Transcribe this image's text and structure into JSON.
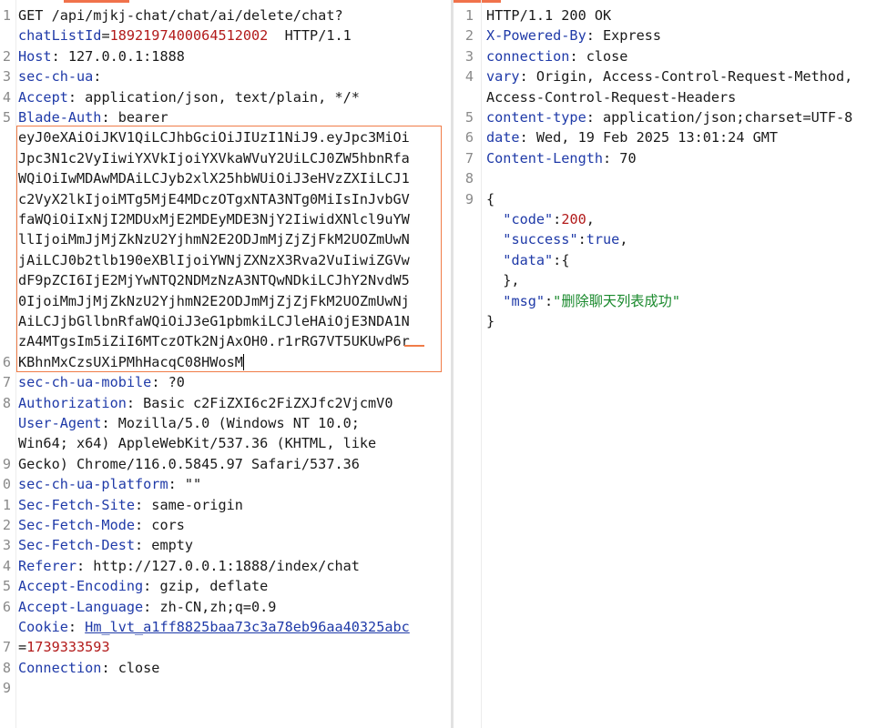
{
  "request": {
    "line_numbers": [
      "1",
      "",
      "2",
      "3",
      "4",
      "5",
      "",
      "",
      "",
      "",
      "",
      "",
      "",
      "",
      "",
      "",
      "",
      "6",
      "7",
      "8",
      "",
      "",
      "9",
      "0",
      "1",
      "2",
      "3",
      "4",
      "5",
      "6",
      "",
      "7",
      "8",
      "9"
    ],
    "lines": [
      {
        "segments": [
          {
            "text": "GET /api/mjkj-chat/chat/ai/delete/chat?",
            "c": "v"
          }
        ]
      },
      {
        "segments": [
          {
            "text": "chatListId",
            "c": "k"
          },
          {
            "text": "=",
            "c": "v"
          },
          {
            "text": "1892197400064512002",
            "c": "r"
          },
          {
            "text": "  HTTP/1.1",
            "c": "v"
          }
        ]
      },
      {
        "segments": [
          {
            "text": "Host",
            "c": "k"
          },
          {
            "text": ": 127.0.0.1:1888",
            "c": "v"
          }
        ]
      },
      {
        "segments": [
          {
            "text": "sec-ch-ua",
            "c": "k"
          },
          {
            "text": ":",
            "c": "v"
          }
        ]
      },
      {
        "segments": [
          {
            "text": "Accept",
            "c": "k"
          },
          {
            "text": ": application/json, text/plain, */*",
            "c": "v"
          }
        ]
      },
      {
        "segments": [
          {
            "text": "Blade-Auth",
            "c": "k"
          },
          {
            "text": ": bearer",
            "c": "v"
          }
        ]
      },
      {
        "segments": [
          {
            "text": "eyJ0eXAiOiJKV1QiLCJhbGciOiJIUzI1NiJ9.eyJpc3MiOi",
            "c": "v"
          }
        ]
      },
      {
        "segments": [
          {
            "text": "Jpc3N1c2VyIiwiYXVkIjoiYXVkaWVuY2UiLCJ0ZW5hbnRfa",
            "c": "v"
          }
        ]
      },
      {
        "segments": [
          {
            "text": "WQiOiIwMDAwMDAiLCJyb2xlX25hbWUiOiJ3eHVzZXIiLCJ1",
            "c": "v"
          }
        ]
      },
      {
        "segments": [
          {
            "text": "c2VyX2lkIjoiMTg5MjE4MDczOTgxNTA3NTg0MiIsInJvbGV",
            "c": "v"
          }
        ]
      },
      {
        "segments": [
          {
            "text": "faWQiOiIxNjI2MDUxMjE2MDEyMDE3NjY2IiwidXNlcl9uYW",
            "c": "v"
          }
        ]
      },
      {
        "segments": [
          {
            "text": "llIjoiMmJjMjZkNzU2YjhmN2E2ODJmMjZjZjFkM2UOZmUwN",
            "c": "v"
          }
        ]
      },
      {
        "segments": [
          {
            "text": "jAiLCJ0b2tlb190eXBlIjoiYWNjZXNzX3Rva2VuIiwiZGVw",
            "c": "v"
          }
        ]
      },
      {
        "segments": [
          {
            "text": "dF9pZCI6IjE2MjYwNTQ2NDMzNzA3NTQwNDkiLCJhY2NvdW5",
            "c": "v"
          }
        ]
      },
      {
        "segments": [
          {
            "text": "0IjoiMmJjMjZkNzU2YjhmN2E2ODJmMjZjZjFkM2UOZmUwNj",
            "c": "v"
          }
        ]
      },
      {
        "segments": [
          {
            "text": "AiLCJjbGllbnRfaWQiOiJ3eG1pbmkiLCJleHAiOjE3NDA1N",
            "c": "v"
          }
        ]
      },
      {
        "segments": [
          {
            "text": "zA4MTgsIm5iZiI6MTczOTk2NjAxOH0.r1rRG7VT5UKUwP6r",
            "c": "v"
          }
        ]
      },
      {
        "segments": [
          {
            "text": "KBhnMxCzsUXiPMhHacqC08HWosM",
            "c": "v"
          }
        ],
        "caret": true
      },
      {
        "segments": [
          {
            "text": "sec-ch-ua-mobile",
            "c": "k"
          },
          {
            "text": ": ?0",
            "c": "v"
          }
        ]
      },
      {
        "segments": [
          {
            "text": "Authorization",
            "c": "k"
          },
          {
            "text": ": Basic c2FiZXI6c2FiZXJfc2VjcmV0",
            "c": "v"
          }
        ]
      },
      {
        "segments": [
          {
            "text": "User-Agent",
            "c": "k"
          },
          {
            "text": ": Mozilla/5.0 (Windows NT 10.0;",
            "c": "v"
          }
        ]
      },
      {
        "segments": [
          {
            "text": "Win64; x64) AppleWebKit/537.36 (KHTML, like",
            "c": "v"
          }
        ]
      },
      {
        "segments": [
          {
            "text": "Gecko) Chrome/116.0.5845.97 Safari/537.36",
            "c": "v"
          }
        ]
      },
      {
        "segments": [
          {
            "text": "sec-ch-ua-platform",
            "c": "k"
          },
          {
            "text": ": \"\"",
            "c": "v"
          }
        ]
      },
      {
        "segments": [
          {
            "text": "Sec-Fetch-Site",
            "c": "k"
          },
          {
            "text": ": same-origin",
            "c": "v"
          }
        ]
      },
      {
        "segments": [
          {
            "text": "Sec-Fetch-Mode",
            "c": "k"
          },
          {
            "text": ": cors",
            "c": "v"
          }
        ]
      },
      {
        "segments": [
          {
            "text": "Sec-Fetch-Dest",
            "c": "k"
          },
          {
            "text": ": empty",
            "c": "v"
          }
        ]
      },
      {
        "segments": [
          {
            "text": "Referer",
            "c": "k"
          },
          {
            "text": ": http://127.0.0.1:1888/index/chat",
            "c": "v"
          }
        ]
      },
      {
        "segments": [
          {
            "text": "Accept-Encoding",
            "c": "k"
          },
          {
            "text": ": gzip, deflate",
            "c": "v"
          }
        ]
      },
      {
        "segments": [
          {
            "text": "Accept-Language",
            "c": "k"
          },
          {
            "text": ": zh-CN,zh;q=0.9",
            "c": "v"
          }
        ]
      },
      {
        "segments": [
          {
            "text": "Cookie",
            "c": "k"
          },
          {
            "text": ": ",
            "c": "v"
          },
          {
            "text": "Hm_lvt_a1ff8825baa73c3a78eb96aa40325abc",
            "c": "k u"
          }
        ]
      },
      {
        "segments": [
          {
            "text": "=",
            "c": "v"
          },
          {
            "text": "1739333593",
            "c": "r"
          }
        ]
      },
      {
        "segments": [
          {
            "text": "Connection",
            "c": "k"
          },
          {
            "text": ": close",
            "c": "v"
          }
        ]
      },
      {
        "segments": []
      }
    ]
  },
  "response": {
    "line_numbers": [
      "1",
      "2",
      "3",
      "4",
      "",
      "5",
      "6",
      "7",
      "8",
      "9",
      "",
      "",
      "",
      "",
      "",
      ""
    ],
    "lines": [
      {
        "segments": [
          {
            "text": "HTTP/1.1 200 OK",
            "c": "v"
          }
        ]
      },
      {
        "segments": [
          {
            "text": "X-Powered-By",
            "c": "k"
          },
          {
            "text": ": Express",
            "c": "v"
          }
        ]
      },
      {
        "segments": [
          {
            "text": "connection",
            "c": "k"
          },
          {
            "text": ": close",
            "c": "v"
          }
        ]
      },
      {
        "segments": [
          {
            "text": "vary",
            "c": "k"
          },
          {
            "text": ": Origin, Access-Control-Request-Method,",
            "c": "v"
          }
        ]
      },
      {
        "segments": [
          {
            "text": "Access-Control-Request-Headers",
            "c": "v"
          }
        ]
      },
      {
        "segments": [
          {
            "text": "content-type",
            "c": "k"
          },
          {
            "text": ": application/json;charset=UTF-8",
            "c": "v"
          }
        ]
      },
      {
        "segments": [
          {
            "text": "date",
            "c": "k"
          },
          {
            "text": ": Wed, 19 Feb 2025 13:01:24 GMT",
            "c": "v"
          }
        ]
      },
      {
        "segments": [
          {
            "text": "Content-Length",
            "c": "k"
          },
          {
            "text": ": 70",
            "c": "v"
          }
        ]
      },
      {
        "segments": []
      },
      {
        "segments": [
          {
            "text": "{",
            "c": "p"
          }
        ]
      },
      {
        "segments": [
          {
            "text": "  ",
            "c": "p"
          },
          {
            "text": "\"code\"",
            "c": "k"
          },
          {
            "text": ":",
            "c": "p"
          },
          {
            "text": "200",
            "c": "r"
          },
          {
            "text": ",",
            "c": "p"
          }
        ]
      },
      {
        "segments": [
          {
            "text": "  ",
            "c": "p"
          },
          {
            "text": "\"success\"",
            "c": "k"
          },
          {
            "text": ":",
            "c": "p"
          },
          {
            "text": "true",
            "c": "k"
          },
          {
            "text": ",",
            "c": "p"
          }
        ]
      },
      {
        "segments": [
          {
            "text": "  ",
            "c": "p"
          },
          {
            "text": "\"data\"",
            "c": "k"
          },
          {
            "text": ":{",
            "c": "p"
          }
        ]
      },
      {
        "segments": [
          {
            "text": "  },",
            "c": "p"
          }
        ]
      },
      {
        "segments": [
          {
            "text": "  ",
            "c": "p"
          },
          {
            "text": "\"msg\"",
            "c": "k"
          },
          {
            "text": ":",
            "c": "p"
          },
          {
            "text": "\"删除聊天列表成功\"",
            "c": "s"
          }
        ]
      },
      {
        "segments": [
          {
            "text": "}",
            "c": "p"
          }
        ]
      }
    ]
  },
  "colors": {
    "key": "#1f3aa8",
    "value": "#1a1a1a",
    "number": "#b21a1a",
    "string": "#1b8a2e",
    "highlight": "#f07c48"
  }
}
